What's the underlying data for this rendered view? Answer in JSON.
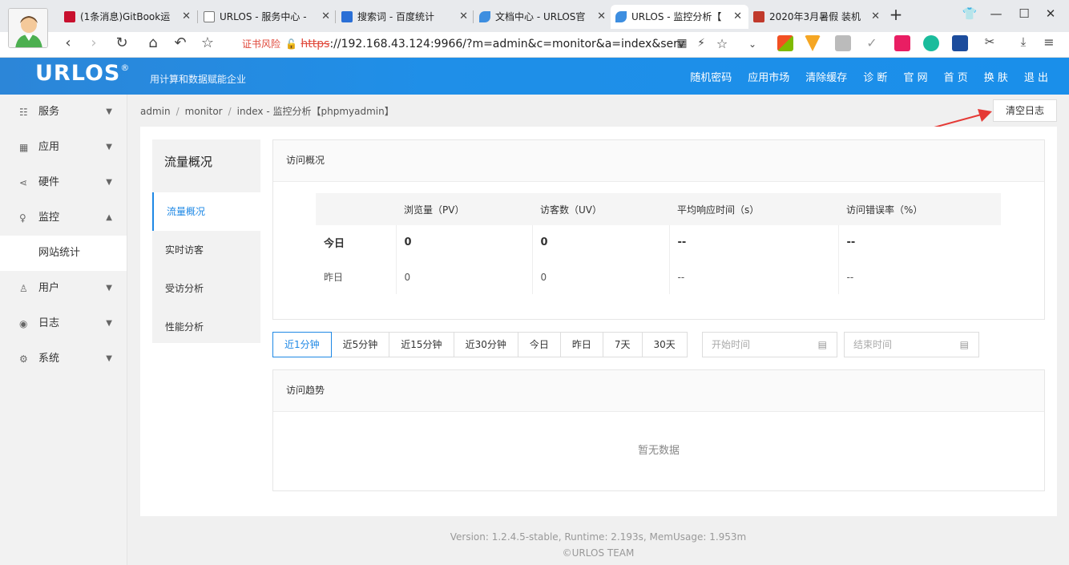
{
  "browser": {
    "tabs": [
      {
        "label": "(1条消息)GitBook运",
        "icon_color": "#c8102e",
        "icon_name": "csdn-icon"
      },
      {
        "label": "URLOS - 服务中心 -",
        "icon_color": "#ffffff",
        "icon_name": "page-icon"
      },
      {
        "label": "搜索词 - 百度统计",
        "icon_color": "#2a6fd6",
        "icon_name": "chart-icon"
      },
      {
        "label": "文档中心 - URLOS官",
        "icon_color": "#3d8ee0",
        "icon_name": "bird-icon"
      },
      {
        "label": "URLOS - 监控分析【",
        "icon_color": "#3d8ee0",
        "icon_name": "bird-icon"
      },
      {
        "label": "2020年3月暑假 装机",
        "icon_color": "#c0392b",
        "icon_name": "r-icon"
      }
    ],
    "cert_warning": "证书风险",
    "url_scheme": "https",
    "url_rest": "://192.168.43.124:9966/?m=admin&c=monitor&a=index&serv"
  },
  "app": {
    "logo": "URLOS",
    "logo_mark": "®",
    "slogan": "用计算和数据赋能企业",
    "topmenu": [
      "随机密码",
      "应用市场",
      "清除缓存",
      "诊 断",
      "官 网",
      "首 页",
      "换 肤",
      "退 出"
    ]
  },
  "sidebar": {
    "items": [
      {
        "label": "服务",
        "icon": "grid-icon",
        "chev": "⌄"
      },
      {
        "label": "应用",
        "icon": "apps-icon",
        "chev": "⌄"
      },
      {
        "label": "硬件",
        "icon": "share-icon",
        "chev": "⌄"
      },
      {
        "label": "监控",
        "icon": "bulb-icon",
        "chev": "⌃"
      },
      {
        "label": "网站统计",
        "sub": true
      },
      {
        "label": "用户",
        "icon": "user-icon",
        "chev": "⌄"
      },
      {
        "label": "日志",
        "icon": "eye-icon",
        "chev": "⌄"
      },
      {
        "label": "系统",
        "icon": "gear-icon",
        "chev": "⌄"
      }
    ]
  },
  "breadcrumb": [
    "admin",
    "monitor",
    "index",
    "-",
    "监控分析【phpmyadmin】"
  ],
  "clear_log": "清空日志",
  "subnav": {
    "title": "流量概况",
    "items": [
      "流量概况",
      "实时访客",
      "受访分析",
      "性能分析"
    ]
  },
  "overview": {
    "title": "访问概况",
    "headers": [
      "",
      "浏览量（PV）",
      "访客数（UV）",
      "平均响应时间（s）",
      "访问错误率（%）"
    ],
    "rows": [
      [
        "今日",
        "0",
        "0",
        "--",
        "--"
      ],
      [
        "昨日",
        "0",
        "0",
        "--",
        "--"
      ]
    ]
  },
  "ranges": [
    "近1分钟",
    "近5分钟",
    "近15分钟",
    "近30分钟",
    "今日",
    "昨日",
    "7天",
    "30天"
  ],
  "start_placeholder": "开始时间",
  "end_placeholder": "结束时间",
  "trend": {
    "title": "访问趋势",
    "empty": "暂无数据"
  },
  "footer": {
    "line1": "Version: 1.2.4.5-stable,   Runtime: 2.193s,   MemUsage: 1.953m",
    "line2": "©URLOS TEAM"
  }
}
